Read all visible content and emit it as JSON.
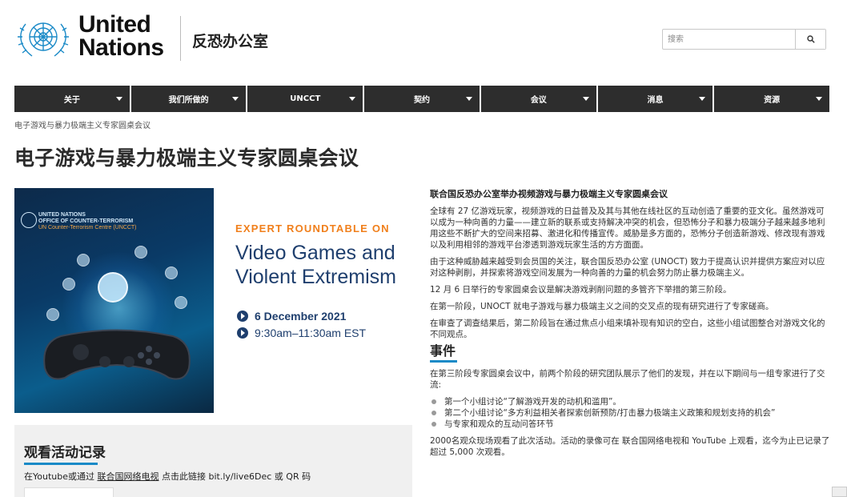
{
  "header": {
    "logo_line1": "United",
    "logo_line2": "Nations",
    "office_name": "反恐办公室",
    "search_placeholder": "搜索",
    "search_icon": "search-icon"
  },
  "nav": [
    {
      "label": "关于"
    },
    {
      "label": "我们所做的"
    },
    {
      "label": "UNCCT"
    },
    {
      "label": "契约"
    },
    {
      "label": "会议"
    },
    {
      "label": "消息"
    },
    {
      "label": "资源"
    }
  ],
  "breadcrumb": "电子游戏与暴力极端主义专家圆桌会议",
  "page_title": "电子游戏与暴力极端主义专家圆桌会议",
  "poster": {
    "org_line1": "UNITED NATIONS",
    "org_line2": "OFFICE OF COUNTER-TERRORISM",
    "org_line3": "UN Counter-Terrorism Centre (UNCCT)",
    "eyebrow": "EXPERT ROUNDTABLE ON",
    "title_line1": "Video Games and",
    "title_line2": "Violent Extremism",
    "date": "6 December 2021",
    "time": "9:30am–11:30am EST"
  },
  "panel": {
    "title": "观看活动记录",
    "line_prefix": "在Youtube或通过",
    "line_link": "联合国网络电视",
    "line_suffix": "点击此链接 bit.ly/live6Dec 或 QR 码"
  },
  "article": {
    "heading": "联合国反恐办公室举办视频游戏与暴力极端主义专家圆桌会议",
    "p1": "全球有 27 亿游戏玩家，视频游戏的日益普及及其与其他在线社区的互动创造了重要的亚文化。虽然游戏可以成为一种向善的力量——建立新的联系或支持解决冲突的机会，但恐怖分子和暴力极端分子越来越多地利用这些不断扩大的空间来招募、激进化和传播宣传。威胁是多方面的，恐怖分子创造新游戏、修改现有游戏以及利用相邻的游戏平台渗透到游戏玩家生活的方方面面。",
    "p2": "由于这种威胁越来越受到会员国的关注，联合国反恐办公室 (UNOCT) 致力于提高认识并提供方案应对以应对这种剥削，并探索将游戏空间发展为一种向善的力量的机会努力防止暴力极端主义。",
    "p3": "12 月 6 日举行的专家圆桌会议是解决游戏剥削问题的多管齐下举措的第三阶段。",
    "p4": "在第一阶段，UNOCT 就电子游戏与暴力极端主义之间的交叉点的现有研究进行了专家磋商。",
    "p5": "在审查了调查结果后，第二阶段旨在通过焦点小组来填补现有知识的空白，这些小组试图整合对游戏文化的不同观点。",
    "section_title": "事件",
    "p6": "在第三阶段专家圆桌会议中，前两个阶段的研究团队展示了他们的发现，并在以下期间与一组专家进行了交流:",
    "bullets": [
      "第一个小组讨论“了解游戏开发的动机和滥用”。",
      "第二个小组讨论“多方利益相关者探索创新预防/打击暴力极端主义政策和规划支持的机会”",
      "与专家和观众的互动问答环节"
    ],
    "p7": "2000名观众现场观看了此次活动。活动的录像可在 联合国网络电视和 YouTube 上观看，迄今为止已记录了超过 5,000 次观看。"
  },
  "colors": {
    "nav_bg": "#2d2d2d",
    "accent_blue": "#1a8ac7",
    "poster_orange": "#f07f1b",
    "poster_navy": "#1f3f6e"
  }
}
